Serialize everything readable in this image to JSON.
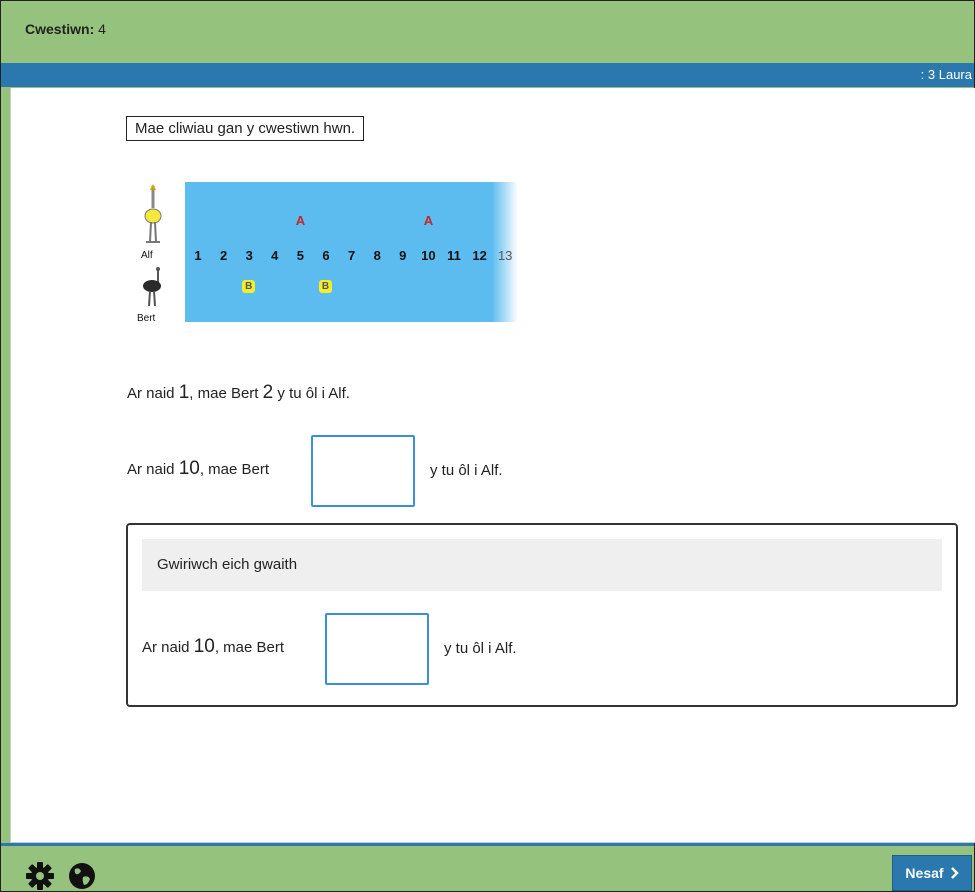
{
  "header": {
    "question_label": "Cwestiwn:",
    "question_number": "4"
  },
  "user_bar": {
    "user": ": 3 Laura"
  },
  "hint": {
    "text": "Mae cliwiau gan y cwestiwn hwn."
  },
  "track": {
    "numbers": [
      "1",
      "2",
      "3",
      "4",
      "5",
      "6",
      "7",
      "8",
      "9",
      "10",
      "11",
      "12",
      "13"
    ],
    "a_marks": [
      5,
      10
    ],
    "b_marks": [
      3,
      6
    ],
    "a_symbol": "A",
    "b_symbol": "B",
    "alf_label": "Alf",
    "bert_label": "Bert"
  },
  "sentence1": {
    "pre": "Ar naid",
    "num": "1",
    "mid": ", mae Bert",
    "num2": "2",
    "post": "y tu ôl i Alf."
  },
  "sentence2": {
    "pre": "Ar naid",
    "num": "10",
    "mid": ", mae Bert",
    "post": "y tu ôl i Alf.",
    "answer": ""
  },
  "check": {
    "title": "Gwiriwch eich gwaith",
    "pre": "Ar naid",
    "num": "10",
    "mid": ", mae Bert",
    "post": "y tu ôl i Alf.",
    "answer": ""
  },
  "footer": {
    "next_label": "Nesaf"
  },
  "colors": {
    "green": "#95c37d",
    "blue": "#2a78ad",
    "track": "#5cbcf0",
    "a_mark": "#c22626",
    "b_mark": "#f4ee2a"
  }
}
